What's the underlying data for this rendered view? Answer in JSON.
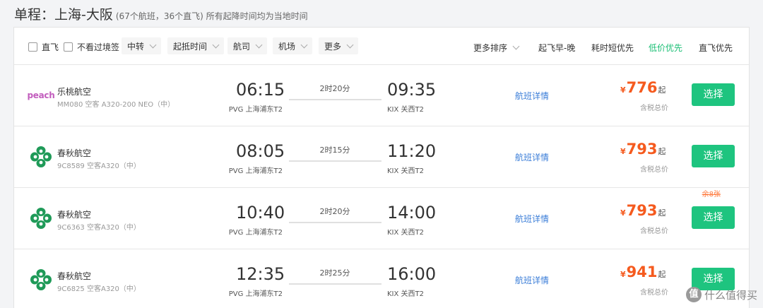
{
  "header": {
    "title": "单程：",
    "route": "上海-大阪",
    "subtitle": "(67个航班，36个直飞) 所有起降时间均为当地时间"
  },
  "filters": {
    "direct_label": "直飞",
    "no_visa_label": "不看过境签",
    "dropdowns": [
      "中转",
      "起抵时间",
      "航司",
      "机场",
      "更多"
    ]
  },
  "sort": {
    "more_label": "更多排序",
    "options": [
      "起飞早-晚",
      "耗时短优先",
      "低价优先",
      "直飞优先"
    ],
    "active": "低价优先",
    "active_color": "#1bbf75"
  },
  "colors": {
    "price": "#f55a1e",
    "button": "#1ec47f",
    "link": "#3b7ed8"
  },
  "flights": [
    {
      "logo_icon": "peach-logo",
      "logo_text": "peach",
      "airline": "乐桃航空",
      "flight_info": "MM080 空客 A320-200 NEO（中）",
      "dep_time": "06:15",
      "dep_airport": "PVG 上海浦东T2",
      "duration": "2时20分",
      "arr_time": "09:35",
      "arr_airport": "KIX 关西T2",
      "detail_link": "航班详情",
      "currency": "¥",
      "price": "776",
      "price_suffix": "起",
      "price_note": "含税总价",
      "seats_left": "",
      "button": "选择"
    },
    {
      "logo_icon": "spring-airlines-logo",
      "airline": "春秋航空",
      "flight_info": "9C8589 空客A320（中）",
      "dep_time": "08:05",
      "dep_airport": "PVG 上海浦东T2",
      "duration": "2时15分",
      "arr_time": "11:20",
      "arr_airport": "KIX 关西T2",
      "detail_link": "航班详情",
      "currency": "¥",
      "price": "793",
      "price_suffix": "起",
      "price_note": "含税总价",
      "seats_left": "",
      "button": "选择"
    },
    {
      "logo_icon": "spring-airlines-logo",
      "airline": "春秋航空",
      "flight_info": "9C6363 空客A320（中）",
      "dep_time": "10:40",
      "dep_airport": "PVG 上海浦东T2",
      "duration": "2时20分",
      "arr_time": "14:00",
      "arr_airport": "KIX 关西T2",
      "detail_link": "航班详情",
      "currency": "¥",
      "price": "793",
      "price_suffix": "起",
      "price_note": "含税总价",
      "seats_left": "余8张",
      "button": "选择"
    },
    {
      "logo_icon": "spring-airlines-logo",
      "airline": "春秋航空",
      "flight_info": "9C6825 空客A320（中）",
      "dep_time": "12:35",
      "dep_airport": "PVG 上海浦东T2",
      "duration": "2时25分",
      "arr_time": "16:00",
      "arr_airport": "KIX 关西T2",
      "detail_link": "航班详情",
      "currency": "¥",
      "price": "941",
      "price_suffix": "起",
      "price_note": "含税总价",
      "seats_left": "",
      "button": "选择"
    }
  ],
  "watermark": {
    "icon": "值",
    "text": "什么值得买"
  }
}
